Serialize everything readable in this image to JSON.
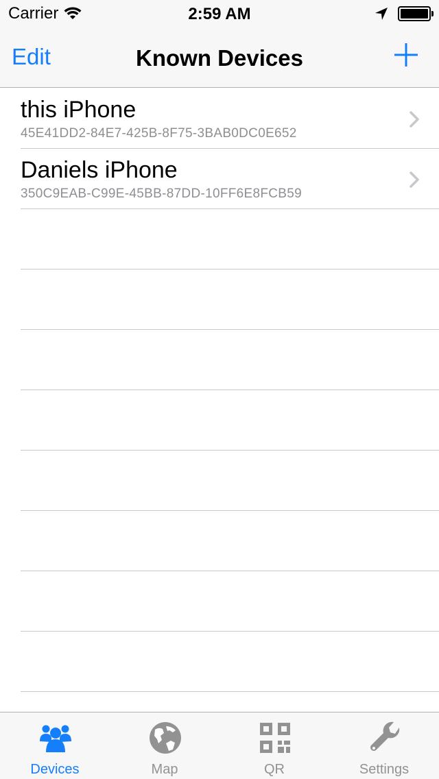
{
  "status_bar": {
    "carrier": "Carrier",
    "time": "2:59 AM",
    "battery_level": 1.0
  },
  "nav": {
    "edit_label": "Edit",
    "title": "Known Devices",
    "add_icon": "plus-icon"
  },
  "devices": [
    {
      "name": "this iPhone",
      "uuid": "45E41DD2-84E7-425B-8F75-3BAB0DC0E652"
    },
    {
      "name": "Daniels iPhone",
      "uuid": "350C9EAB-C99E-45BB-87DD-10FF6E8FCB59"
    }
  ],
  "tabs": [
    {
      "label": "Devices",
      "icon": "people-icon",
      "active": true
    },
    {
      "label": "Map",
      "icon": "globe-icon",
      "active": false
    },
    {
      "label": "QR",
      "icon": "qr-code-icon",
      "active": false
    },
    {
      "label": "Settings",
      "icon": "wrench-icon",
      "active": false
    }
  ],
  "colors": {
    "accent": "#157efb",
    "inactive": "#929292",
    "subtitle": "#8e8e93",
    "separator": "#c8c7cc",
    "bar_background": "#f7f7f7"
  }
}
